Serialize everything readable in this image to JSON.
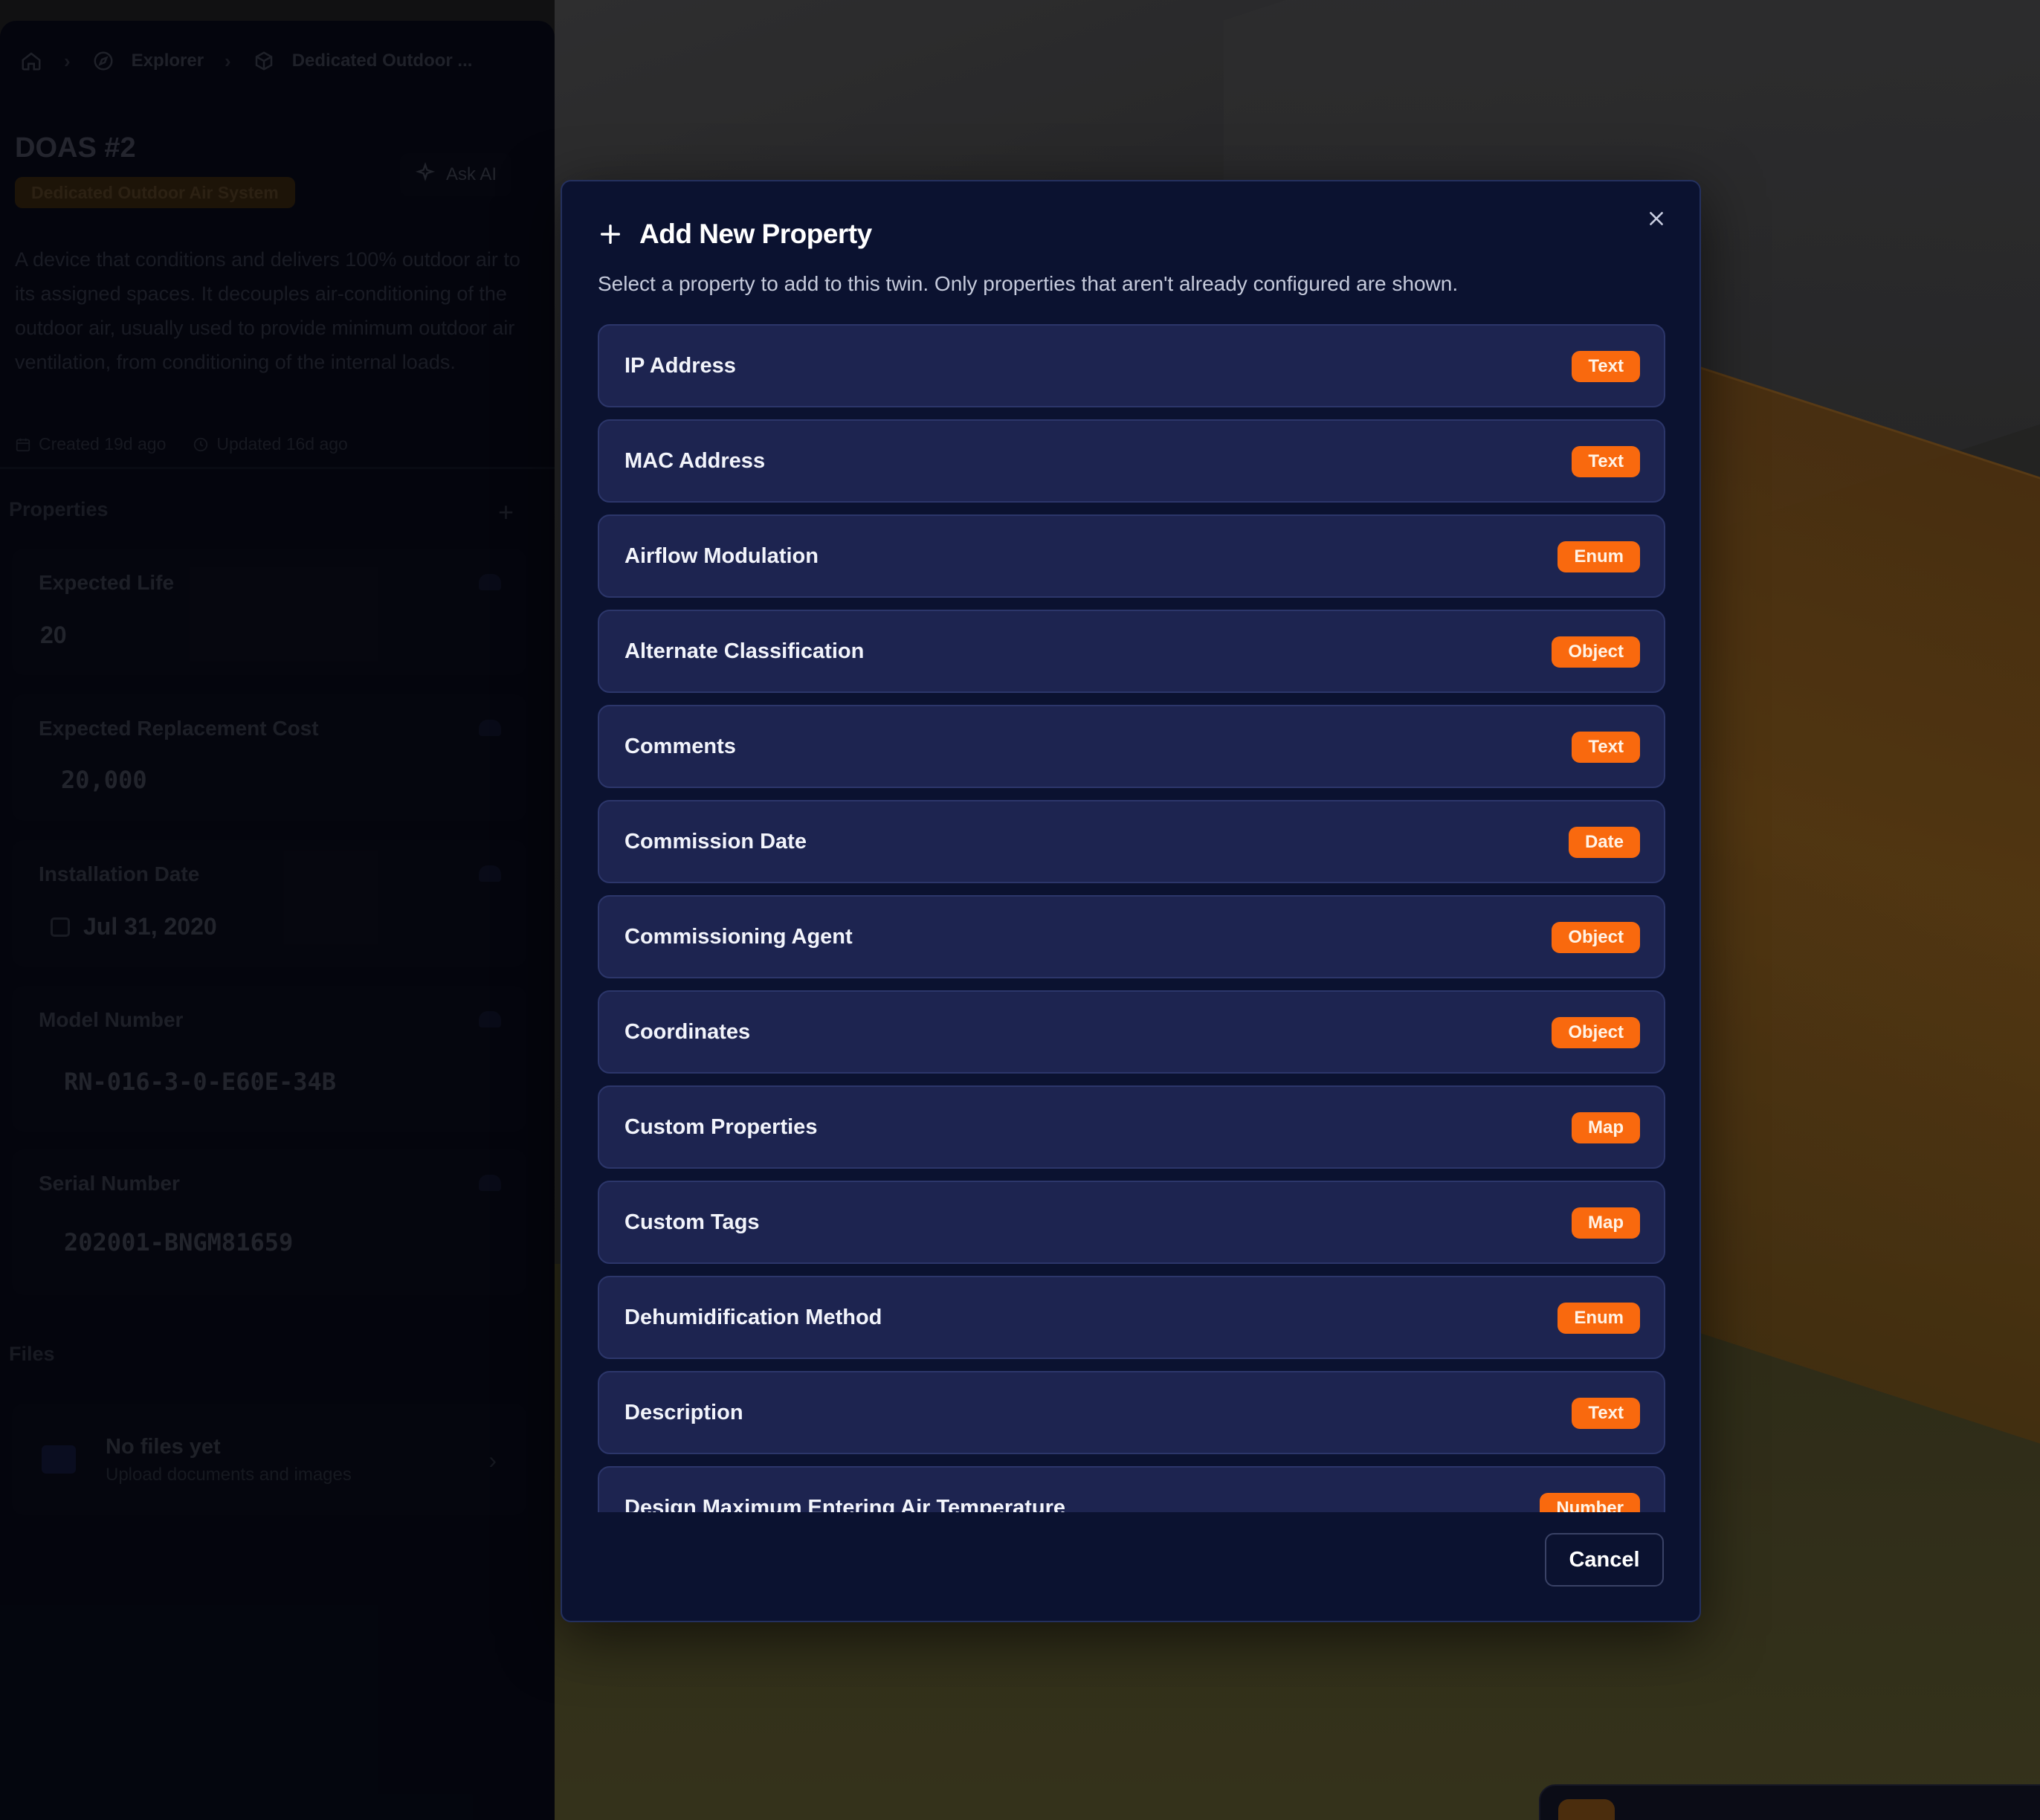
{
  "breadcrumb": {
    "items": [
      {
        "label": "Explorer",
        "icon": "compass-icon"
      },
      {
        "label": "Dedicated Outdoor ...",
        "icon": "cube-icon"
      }
    ]
  },
  "twin": {
    "title": "DOAS #2",
    "type_label": "Dedicated Outdoor Air System",
    "ask_ai_label": "Ask AI",
    "description": "A device that conditions and delivers 100% outdoor air to its assigned spaces. It decouples air-conditioning of the outdoor air, usually used to provide minimum outdoor air ventilation, from conditioning of the internal loads.",
    "created": "Created 19d ago",
    "updated": "Updated 16d ago"
  },
  "properties_section": {
    "title": "Properties",
    "items": [
      {
        "label": "Expected Life",
        "value": "20"
      },
      {
        "label": "Expected Replacement Cost",
        "value": "20,000"
      },
      {
        "label": "Installation Date",
        "value": "Jul 31, 2020"
      },
      {
        "label": "Model Number",
        "value": "RN-016-3-0-E60E-34B"
      },
      {
        "label": "Serial Number",
        "value": "202001-BNGM81659"
      }
    ]
  },
  "files_section": {
    "title": "Files",
    "empty_title": "No files yet",
    "empty_sub": "Upload documents and images"
  },
  "modal": {
    "title": "Add New Property",
    "subtitle": "Select a property to add to this twin. Only properties that aren't already configured are shown.",
    "cancel_label": "Cancel",
    "options": [
      {
        "name": "IP Address",
        "type": "Text"
      },
      {
        "name": "MAC Address",
        "type": "Text"
      },
      {
        "name": "Airflow Modulation",
        "type": "Enum"
      },
      {
        "name": "Alternate Classification",
        "type": "Object"
      },
      {
        "name": "Comments",
        "type": "Text"
      },
      {
        "name": "Commission Date",
        "type": "Date"
      },
      {
        "name": "Commissioning Agent",
        "type": "Object"
      },
      {
        "name": "Coordinates",
        "type": "Object"
      },
      {
        "name": "Custom Properties",
        "type": "Map"
      },
      {
        "name": "Custom Tags",
        "type": "Map"
      },
      {
        "name": "Dehumidification Method",
        "type": "Enum"
      },
      {
        "name": "Description",
        "type": "Text"
      },
      {
        "name": "Design Maximum Entering Air Temperature",
        "type": "Number"
      }
    ]
  },
  "colors": {
    "accent_badge": "#f9690e",
    "modal_bg": "#0b1230",
    "row_bg": "#1d2450"
  }
}
